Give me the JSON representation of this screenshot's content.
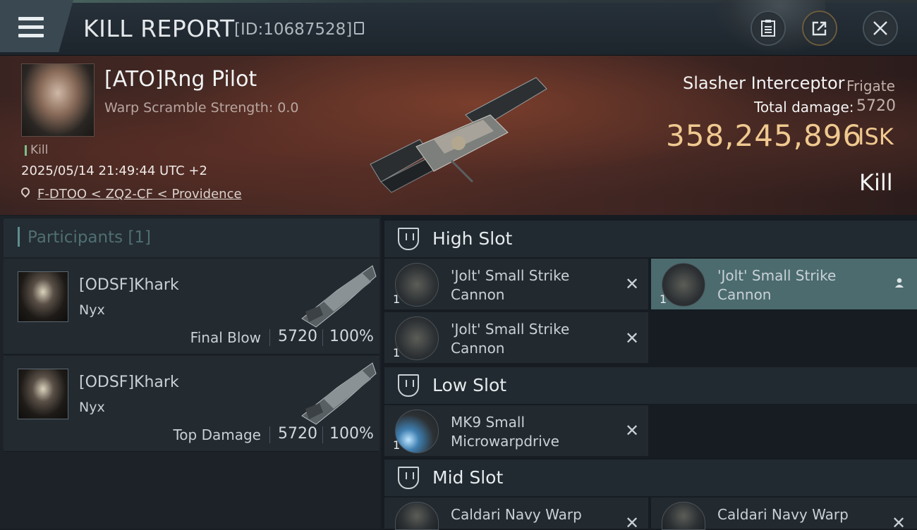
{
  "header": {
    "title": "KILL REPORT",
    "report_id": "[ID:10687528]",
    "icons": [
      "menu-icon",
      "copy-icon",
      "clipboard-icon",
      "share-icon",
      "close-icon"
    ]
  },
  "victim": {
    "name": "[ATO]Rng Pilot",
    "warp_scramble": "Warp Scramble Strength: 0.0",
    "tag": "Kill",
    "datetime": "2025/05/14 21:49:44 UTC +2",
    "location": "F-DTOO < ZQ2-CF < Providence",
    "ship_name": "Slasher Interceptor",
    "ship_class": "Frigate",
    "total_damage_label": "Total damage:",
    "total_damage": "5720",
    "isk_value": "358,245,896",
    "isk_unit": "ISK",
    "result": "Kill"
  },
  "participants": {
    "title": "Participants [1]",
    "items": [
      {
        "name": "[ODSF]Khark",
        "ship": "Nyx",
        "role": "Final Blow",
        "damage": "5720",
        "percent": "100%"
      },
      {
        "name": "[ODSF]Khark",
        "ship": "Nyx",
        "role": "Top Damage",
        "damage": "5720",
        "percent": "100%"
      }
    ]
  },
  "slots": {
    "high": {
      "title": "High Slot",
      "items": [
        {
          "qty": "1",
          "name": "'Jolt' Small Strike Cannon"
        },
        {
          "qty": "1",
          "name": "'Jolt' Small Strike Cannon"
        },
        {
          "qty": "1",
          "name": "'Jolt' Small Strike Cannon"
        }
      ]
    },
    "low": {
      "title": "Low Slot",
      "items": [
        {
          "qty": "1",
          "name": "MK9 Small Microwarpdrive"
        }
      ]
    },
    "mid": {
      "title": "Mid Slot",
      "items": [
        {
          "qty": "",
          "name": "Caldari Navy Warp"
        },
        {
          "qty": "",
          "name": "Caldari Navy Warp"
        }
      ]
    }
  },
  "colors": {
    "isk": "#efc98f",
    "accent_teal": "#4b6b6e",
    "kill_tag": "#7ac08a"
  }
}
